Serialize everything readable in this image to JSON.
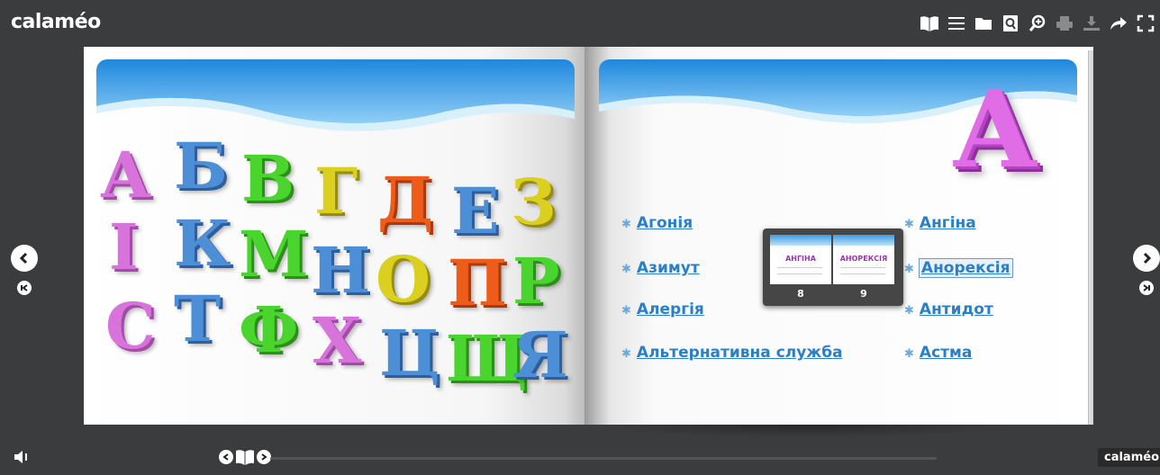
{
  "app": {
    "logo": "calaméo",
    "brand_badge": "calaméo"
  },
  "toolbar": {
    "icons": [
      "book-icon",
      "list-icon",
      "folder-icon",
      "zoom-page-icon",
      "zoom-in-icon",
      "print-icon",
      "download-icon",
      "share-icon",
      "fullscreen-icon"
    ]
  },
  "left_page": {
    "letters": [
      "А",
      "Б",
      "В",
      "Г",
      "Д",
      "Е",
      "З",
      "І",
      "К",
      "М",
      "Н",
      "О",
      "П",
      "Р",
      "С",
      "Т",
      "Ф",
      "Х",
      "Ц",
      "Щ",
      "Я"
    ]
  },
  "right_page": {
    "big_letter": "А",
    "terms_left": [
      "Агонія",
      "Азимут",
      "Алергія",
      "Альтернативна служба"
    ],
    "terms_right": [
      "Ангіна",
      "Анорексія",
      "Антидот",
      "Астма"
    ],
    "highlighted_term": "Анорексія"
  },
  "preview": {
    "thumb_left_title": "АНГІНА",
    "thumb_right_title": "АНОРЕКСІЯ",
    "page_left": "8",
    "page_right": "9"
  },
  "colors": {
    "background": "#3b3c3e",
    "link": "#2a7fc7",
    "accent_pink": "#e06ce6"
  }
}
